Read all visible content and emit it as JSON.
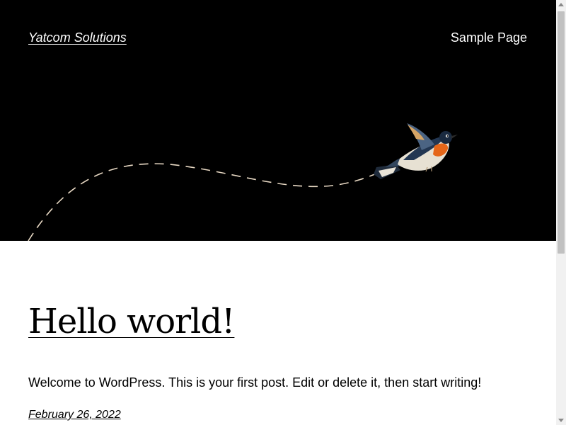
{
  "header": {
    "site_title": "Yatcom Solutions",
    "nav": [
      "Sample Page"
    ]
  },
  "post": {
    "title": "Hello world!",
    "excerpt": "Welcome to WordPress. This is your first post. Edit or delete it, then start writing!",
    "date": "February 26, 2022"
  },
  "colors": {
    "header_bg": "#000000",
    "page_bg": "#ffffff",
    "text": "#000000",
    "header_text": "#ffffff",
    "dashed_path": "#e8d9c4"
  }
}
